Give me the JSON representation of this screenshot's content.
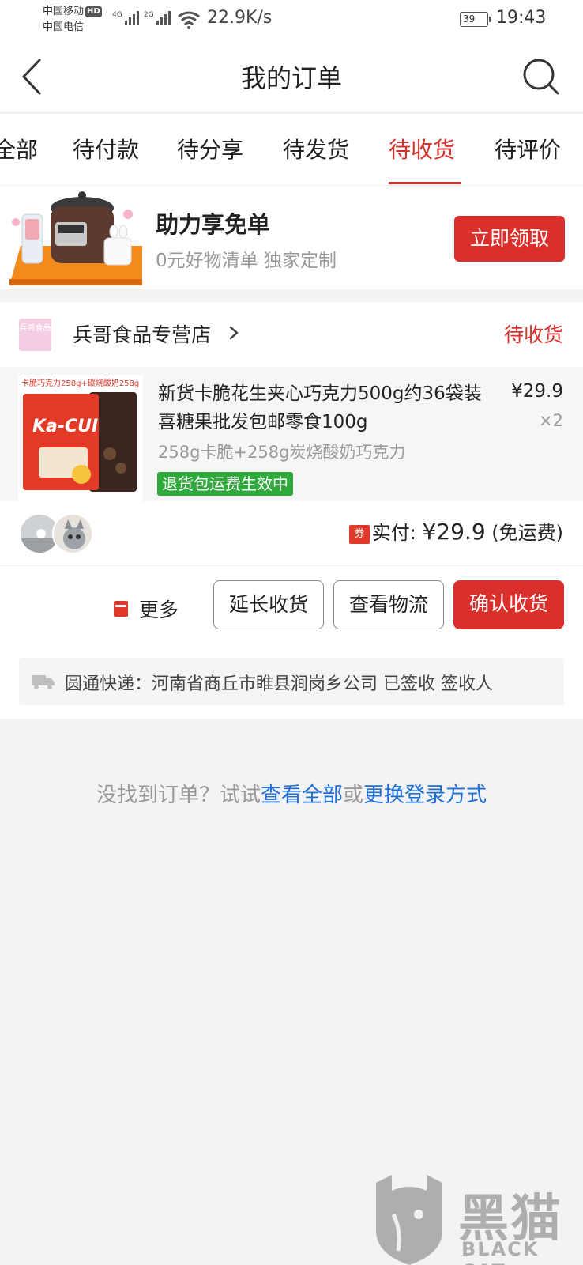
{
  "status_bar": {
    "carrier_1": "中国移动",
    "hd": "HD",
    "carrier_2": "中国电信",
    "net_1": "4G",
    "net_2": "2G",
    "speed": "22.9K/s",
    "battery": "39",
    "time": "19:43"
  },
  "header": {
    "title": "我的订单",
    "back_icon": "chevron-left-icon",
    "search_icon": "search-icon"
  },
  "tabs": [
    {
      "label": "全部"
    },
    {
      "label": "待付款"
    },
    {
      "label": "待分享"
    },
    {
      "label": "待发货"
    },
    {
      "label": "待收货",
      "active": true
    },
    {
      "label": "待评价"
    }
  ],
  "promo": {
    "title": "助力享免单",
    "subtitle": "0元好物清单 独家定制",
    "button": "立即领取"
  },
  "order": {
    "shop_logo_text": "兵哥食品",
    "shop_name": "兵哥食品专营店",
    "status": "待收货",
    "product": {
      "image_banner": "卡脆巧克力258g+碳烧酸奶258g",
      "image_brand": "Ka-CUI",
      "title": "新货卡脆花生夹心巧克力500g约36袋装喜糖果批发包邮零食100g",
      "spec": "258g卡脆+258g炭烧酸奶巧克力",
      "badge": "退货包运费生效中",
      "price": "¥29.9",
      "qty": "×2"
    },
    "coupon_icon": "券",
    "paid_label": "实付: ",
    "paid_amount": "¥29.9",
    "paid_note": " (免运费)",
    "actions": {
      "more": "更多",
      "extend": "延长收货",
      "logistics": "查看物流",
      "confirm": "确认收货"
    },
    "logistics_text": "圆通快递：河南省商丘市睢县涧岗乡公司 已签收  签收人"
  },
  "empty_hint": {
    "prefix": "没找到订单？试试",
    "link1": "查看全部",
    "middle": "或",
    "link2": "更换登录方式"
  },
  "watermark": {
    "cn": "黑猫",
    "en": "BLACK CAT"
  },
  "colors": {
    "accent": "#d9302c",
    "badge_green": "#2fa83c",
    "link_blue": "#1d6fd6"
  }
}
